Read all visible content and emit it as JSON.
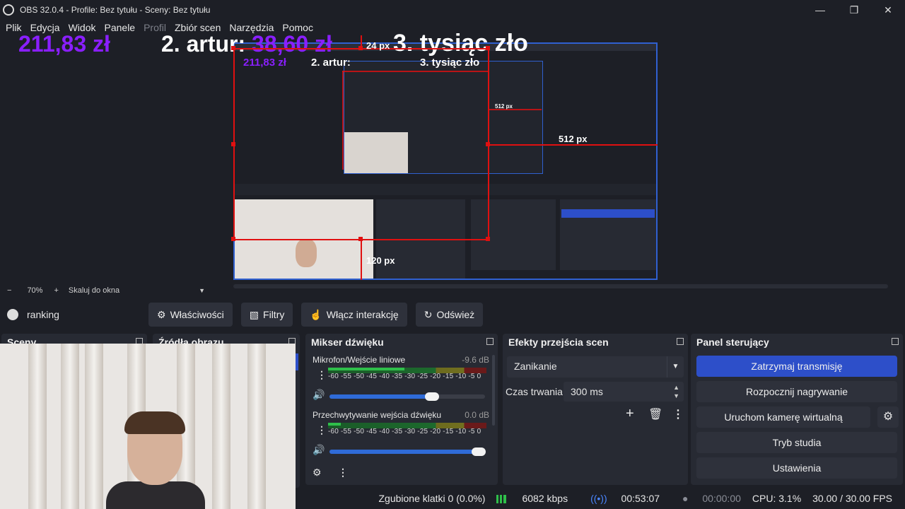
{
  "window": {
    "title": "OBS 32.0.4 - Profile: Bez tytułu - Sceny: Bez tytułu"
  },
  "menu": [
    "Plik",
    "Edycja",
    "Widok",
    "Panele",
    "Profil",
    "Zbiór scen",
    "Narzędzia",
    "Pomoc"
  ],
  "overlays": {
    "amount": "211,83 zł",
    "second_prefix": "2. artur:",
    "second_amount": "38,60 zł",
    "third": "3. tysiąc zło"
  },
  "inner_overlays": {
    "amount": "211,83 zł",
    "second": "2. artur:",
    "third": "3. tysiąc zło"
  },
  "guides": {
    "top": "24 px",
    "right": "512 px",
    "bottom": "120 px",
    "inner_right": "512 px"
  },
  "zoom": {
    "minus": "−",
    "value": "70%",
    "plus": "+",
    "mode": "Skaluj do okna"
  },
  "toolbar": {
    "source_name": "ranking",
    "properties": "Właściwości",
    "filters": "Filtry",
    "interact": "Włącz interakcję",
    "refresh": "Odśwież"
  },
  "docks": {
    "scenes": "Sceny",
    "sources": "Źródła obrazu",
    "mixer": "Mikser dźwięku",
    "transitions": "Efekty przejścia scen",
    "controls": "Panel sterujący"
  },
  "mixer": {
    "channels": [
      {
        "name": "Mikrofon/Wejście liniowe",
        "db": "-9.6 dB",
        "level": 0.48,
        "volume": 0.66
      },
      {
        "name": "Przechwytywanie wejścia dźwięku",
        "db": "0.0 dB",
        "level": 0.08,
        "volume": 0.96
      }
    ],
    "ticks": "-60 -55 -50 -45 -40 -35 -30 -25 -20 -15 -10  -5   0"
  },
  "transitions": {
    "selected": "Zanikanie",
    "duration_label": "Czas trwania",
    "duration": "300 ms"
  },
  "controls": {
    "stop_stream": "Zatrzymaj transmisję",
    "record": "Rozpocznij nagrywanie",
    "virtualcam": "Uruchom kamerę wirtualną",
    "studio": "Tryb studia",
    "settings": "Ustawienia"
  },
  "status": {
    "dropped": "Zgubione klatki 0 (0.0%)",
    "bitrate": "6082 kbps",
    "stream_time": "00:53:07",
    "rec_time": "00:00:00",
    "cpu": "CPU: 3.1%",
    "fps": "30.00 / 30.00 FPS"
  },
  "colors": {
    "accent": "#2d4fc9",
    "overlay_purple": "#8a1fff",
    "guide_red": "#e01010"
  }
}
